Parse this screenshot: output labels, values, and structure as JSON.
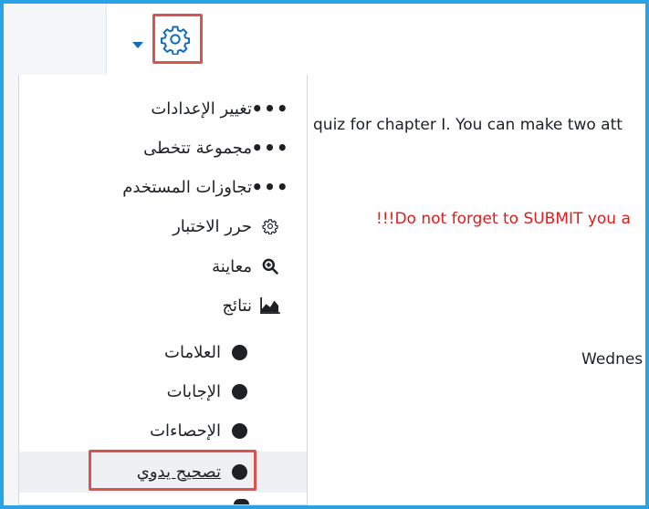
{
  "settings": {
    "gear_icon": "gear-icon",
    "caret_icon": "caret-down-icon",
    "highlight_color": "#d9534f",
    "accent_color": "#0f6cbf"
  },
  "menu": {
    "items": [
      {
        "label": "تغيير الإعدادات",
        "icon": "ellipsis-icon"
      },
      {
        "label": "مجموعة تتخطى",
        "icon": "ellipsis-icon"
      },
      {
        "label": "تجاوزات المستخدم",
        "icon": "ellipsis-icon"
      },
      {
        "label": "حرر الاختبار",
        "icon": "gear-icon"
      },
      {
        "label": "معاينة",
        "icon": "zoom-in-icon"
      },
      {
        "label": "نتائج",
        "icon": "chart-area-icon"
      }
    ],
    "sub_items": [
      {
        "label": "العلامات",
        "icon": "bullet-icon"
      },
      {
        "label": "الإجابات",
        "icon": "bullet-icon"
      },
      {
        "label": "الإحصاءات",
        "icon": "bullet-icon"
      },
      {
        "label": "تصحيح يدوي",
        "icon": "bullet-icon"
      }
    ]
  },
  "content": {
    "intro": "quiz for chapter I. You can make two att",
    "warning": "!!!Do not forget to SUBMIT you a",
    "date_fragment": "Wednes"
  }
}
